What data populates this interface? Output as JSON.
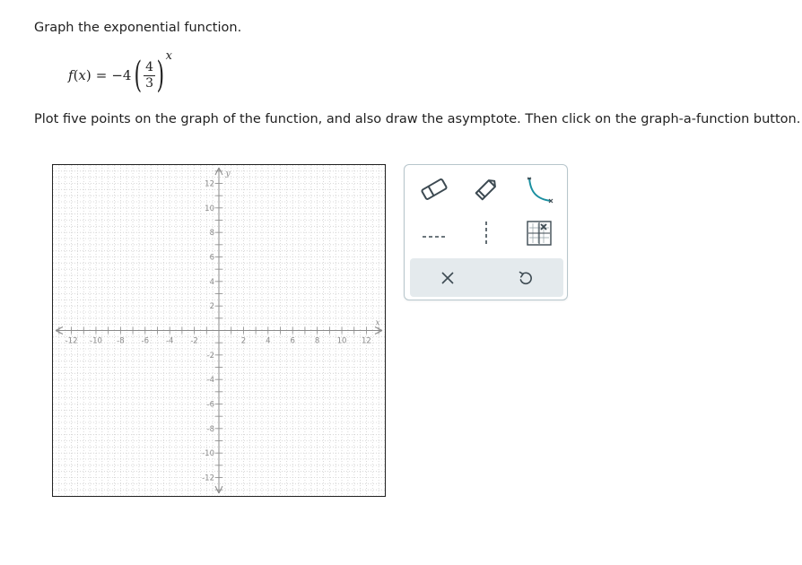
{
  "question": {
    "prompt": "Graph the exponential function.",
    "function": {
      "name": "f",
      "variable": "x",
      "equals": "=",
      "coefficient": "−4",
      "base_numerator": "4",
      "base_denominator": "3",
      "exponent": "x"
    },
    "instructions": "Plot five points on the graph of the function, and also draw the asymptote. Then click on the graph-a-function button."
  },
  "graph": {
    "x_axis_label": "x",
    "y_axis_label": "y",
    "x_range": [
      -13.5,
      13.5
    ],
    "y_range": [
      -13.5,
      13.5
    ],
    "x_tick_labels": [
      "-12",
      "-10",
      "-8",
      "-6",
      "-4",
      "-2",
      "2",
      "4",
      "6",
      "8",
      "10",
      "12"
    ],
    "y_tick_labels": [
      "12",
      "10",
      "8",
      "6",
      "4",
      "2",
      "-2",
      "-4",
      "-6",
      "-8",
      "-10",
      "-12"
    ],
    "grid": true,
    "colors": {
      "grid": "#cfcfcf",
      "axis": "#8a8a8a",
      "tick_label": "#8a8a8a"
    }
  },
  "toolbox": {
    "tools": [
      {
        "name": "eraser-tool",
        "icon": "eraser-icon"
      },
      {
        "name": "pencil-tool",
        "icon": "pencil-icon"
      },
      {
        "name": "exponential-graph-tool",
        "icon": "exponential-curve-icon"
      },
      {
        "name": "horizontal-asymptote-tool",
        "icon": "horizontal-dashed-line-icon"
      },
      {
        "name": "vertical-asymptote-tool",
        "icon": "vertical-dashed-line-icon"
      },
      {
        "name": "graph-a-function-button",
        "icon": "graph-function-icon"
      }
    ],
    "actions": [
      {
        "name": "clear-button",
        "icon": "x-icon"
      },
      {
        "name": "undo-button",
        "icon": "undo-icon"
      }
    ],
    "colors": {
      "icon": "#3d4a52",
      "accent": "#1a8fa0",
      "action_bar": "#e4eaed"
    }
  }
}
